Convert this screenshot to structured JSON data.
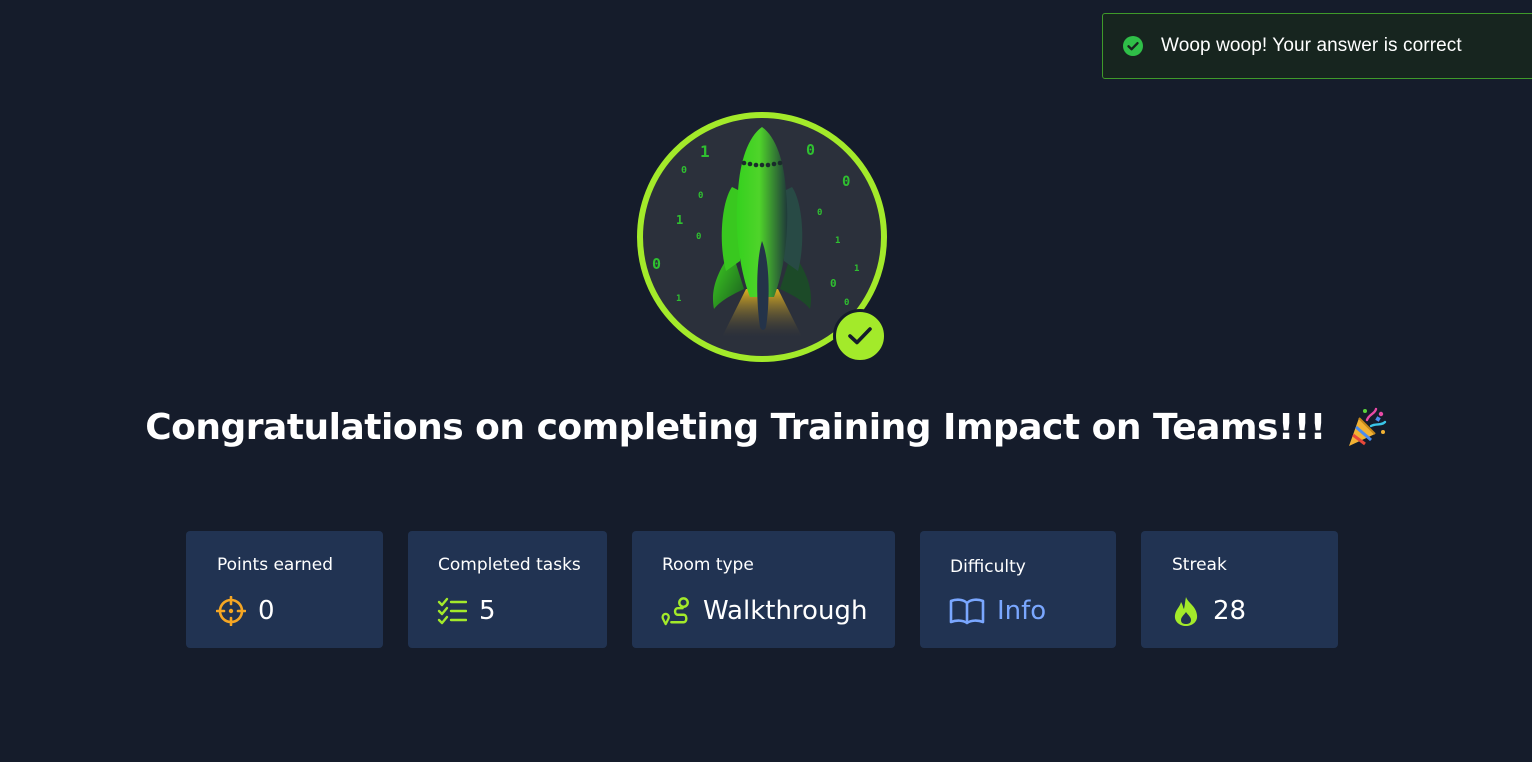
{
  "toast": {
    "message": "Woop woop! Your answer is correct",
    "icon": "check-circle-icon",
    "color": "#3f9a2a"
  },
  "badge": {
    "icon": "rocket-icon",
    "status_icon": "check-icon",
    "ring_color": "#a3ea2a",
    "digits": [
      "1",
      "0",
      "0",
      "0",
      "0",
      "1",
      "0",
      "1",
      "0",
      "0",
      "1",
      "1",
      "0",
      "1",
      "0"
    ]
  },
  "title": {
    "text": "Congratulations on completing Training Impact on Teams!!!",
    "icon": "party-popper-icon"
  },
  "stats": [
    {
      "label": "Points earned",
      "value": "0",
      "icon": "crosshair-icon",
      "icon_color": "#f5a623"
    },
    {
      "label": "Completed tasks",
      "value": "5",
      "icon": "checklist-icon",
      "icon_color": "#a3ea2a"
    },
    {
      "label": "Room type",
      "value": "Walkthrough",
      "icon": "route-icon",
      "icon_color": "#a3ea2a"
    },
    {
      "label": "Difficulty",
      "value": "Info",
      "icon": "book-icon",
      "icon_color": "#7aa7ff"
    },
    {
      "label": "Streak",
      "value": "28",
      "icon": "flame-icon",
      "icon_color": "#a3ea2a"
    }
  ]
}
